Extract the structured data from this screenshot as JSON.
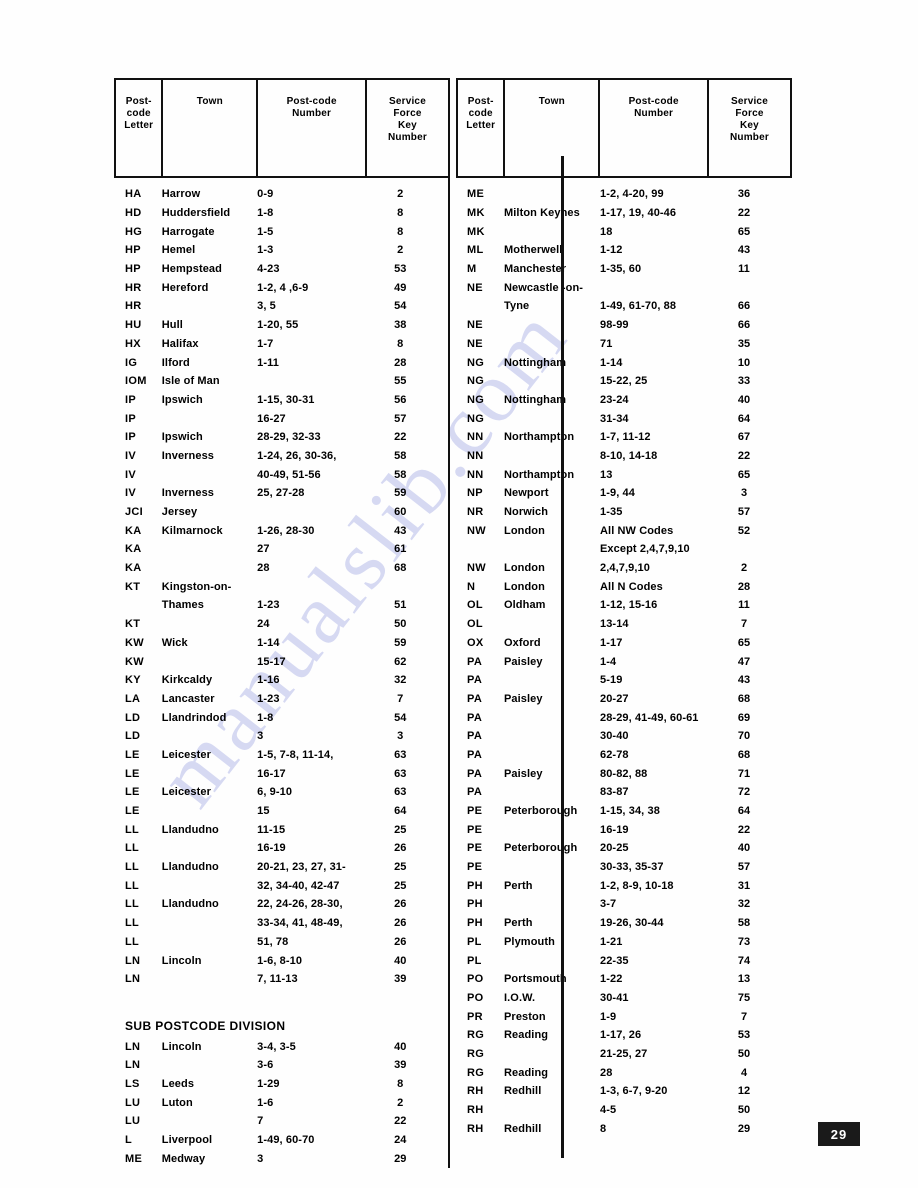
{
  "document": {
    "page_number": "29",
    "watermark_text": "manualslib.com"
  },
  "columns": {
    "postcode_letter": "Post-\ncode\nLetter",
    "postcode_letter_l1": "Post-",
    "postcode_letter_l2": "code",
    "postcode_letter_l3": "Letter",
    "town": "Town",
    "postcode_number_l1": "Post-code",
    "postcode_number_l2": "Number",
    "service_force_l1": "Service",
    "service_force_l2": "Force",
    "service_force_l3": "Key",
    "service_force_l4": "Number"
  },
  "left_table": {
    "rows": [
      {
        "letter": "HA",
        "town": "Harrow",
        "code": "0-9",
        "key": "2"
      },
      {
        "letter": "HD",
        "town": "Huddersfield",
        "code": "1-8",
        "key": "8"
      },
      {
        "letter": "HG",
        "town": "Harrogate",
        "code": "1-5",
        "key": "8"
      },
      {
        "letter": "HP",
        "town": "Hemel",
        "code": "1-3",
        "key": "2"
      },
      {
        "letter": "HP",
        "town": "Hempstead",
        "code": "4-23",
        "key": "53"
      },
      {
        "letter": "HR",
        "town": "Hereford",
        "code": "1-2, 4 ,6-9",
        "key": "49"
      },
      {
        "letter": "HR",
        "town": "",
        "code": "3, 5",
        "key": "54"
      },
      {
        "letter": "HU",
        "town": "Hull",
        "code": "1-20, 55",
        "key": "38"
      },
      {
        "letter": "HX",
        "town": "Halifax",
        "code": "1-7",
        "key": "8"
      },
      {
        "letter": "IG",
        "town": "Ilford",
        "code": "1-11",
        "key": "28"
      },
      {
        "letter": "IOM",
        "town": "Isle of Man",
        "code": "",
        "key": "55"
      },
      {
        "letter": "IP",
        "town": "Ipswich",
        "code": "1-15, 30-31",
        "key": "56"
      },
      {
        "letter": "IP",
        "town": "",
        "code": "16-27",
        "key": "57"
      },
      {
        "letter": "IP",
        "town": "Ipswich",
        "code": "28-29, 32-33",
        "key": "22"
      },
      {
        "letter": "IV",
        "town": "Inverness",
        "code": "1-24, 26, 30-36,",
        "key": "58"
      },
      {
        "letter": "IV",
        "town": "",
        "code": "40-49, 51-56",
        "key": "58"
      },
      {
        "letter": "IV",
        "town": "Inverness",
        "code": "25, 27-28",
        "key": "59"
      },
      {
        "letter": "JCI",
        "town": "Jersey",
        "code": "",
        "key": "60"
      },
      {
        "letter": "KA",
        "town": "Kilmarnock",
        "code": "1-26, 28-30",
        "key": "43"
      },
      {
        "letter": "KA",
        "town": "",
        "code": "27",
        "key": "61"
      },
      {
        "letter": "KA",
        "town": "",
        "code": "28",
        "key": "68"
      },
      {
        "letter": "KT",
        "town": "Kingston-on-",
        "code": "",
        "key": ""
      },
      {
        "letter": "",
        "town": "Thames",
        "code": "1-23",
        "key": "51"
      },
      {
        "letter": "KT",
        "town": "",
        "code": "24",
        "key": "50"
      },
      {
        "letter": "KW",
        "town": "Wick",
        "code": "1-14",
        "key": "59"
      },
      {
        "letter": "KW",
        "town": "",
        "code": "15-17",
        "key": "62"
      },
      {
        "letter": "KY",
        "town": "Kirkcaldy",
        "code": "1-16",
        "key": "32"
      },
      {
        "letter": "LA",
        "town": "Lancaster",
        "code": "1-23",
        "key": "7"
      },
      {
        "letter": "LD",
        "town": "Llandrindod",
        "code": "1-8",
        "key": "54"
      },
      {
        "letter": "LD",
        "town": "",
        "code": "3",
        "key": "3"
      },
      {
        "letter": "LE",
        "town": "Leicester",
        "code": "1-5, 7-8, 11-14,",
        "key": "63"
      },
      {
        "letter": "LE",
        "town": "",
        "code": "16-17",
        "key": "63"
      },
      {
        "letter": "LE",
        "town": "Leicester",
        "code": "6, 9-10",
        "key": "63"
      },
      {
        "letter": "LE",
        "town": "",
        "code": "15",
        "key": "64"
      },
      {
        "letter": "LL",
        "town": "Llandudno",
        "code": "11-15",
        "key": "25"
      },
      {
        "letter": "LL",
        "town": "",
        "code": "16-19",
        "key": "26"
      },
      {
        "letter": "LL",
        "town": "Llandudno",
        "code": "20-21, 23, 27, 31-",
        "key": "25"
      },
      {
        "letter": "LL",
        "town": "",
        "code": "32, 34-40, 42-47",
        "key": "25"
      },
      {
        "letter": "LL",
        "town": "Llandudno",
        "code": "22, 24-26, 28-30,",
        "key": "26"
      },
      {
        "letter": "LL",
        "town": "",
        "code": "33-34, 41, 48-49,",
        "key": "26"
      },
      {
        "letter": "LL",
        "town": "",
        "code": "51, 78",
        "key": "26"
      },
      {
        "letter": "LN",
        "town": "Lincoln",
        "code": "1-6, 8-10",
        "key": "40"
      },
      {
        "letter": "LN",
        "town": "",
        "code": "7, 11-13",
        "key": "39"
      }
    ],
    "sub_section": {
      "title": "SUB POSTCODE DIVISION",
      "rows": [
        {
          "letter": "LN",
          "town": "Lincoln",
          "code": "3-4, 3-5",
          "key": "40"
        },
        {
          "letter": "LN",
          "town": "",
          "code": "3-6",
          "key": "39"
        },
        {
          "letter": "LS",
          "town": "Leeds",
          "code": "1-29",
          "key": "8"
        },
        {
          "letter": "LU",
          "town": "Luton",
          "code": "1-6",
          "key": "2"
        },
        {
          "letter": "LU",
          "town": "",
          "code": "7",
          "key": "22"
        },
        {
          "letter": "L",
          "town": "Liverpool",
          "code": "1-49, 60-70",
          "key": "24"
        },
        {
          "letter": "ME",
          "town": "Medway",
          "code": "3",
          "key": "29"
        }
      ]
    }
  },
  "right_table": {
    "rows": [
      {
        "letter": "ME",
        "town": "",
        "code": "1-2, 4-20, 99",
        "key": "36"
      },
      {
        "letter": "MK",
        "town": "Milton Keynes",
        "code": "1-17, 19, 40-46",
        "key": "22"
      },
      {
        "letter": "MK",
        "town": "",
        "code": "18",
        "key": "65"
      },
      {
        "letter": "ML",
        "town": "Motherwell",
        "code": "1-12",
        "key": "43"
      },
      {
        "letter": "M",
        "town": "Manchester",
        "code": "1-35, 60",
        "key": "11"
      },
      {
        "letter": "NE",
        "town": "Newcastle -on-",
        "code": "",
        "key": ""
      },
      {
        "letter": "",
        "town": "Tyne",
        "code": "1-49, 61-70, 88",
        "key": "66"
      },
      {
        "letter": "NE",
        "town": "",
        "code": "98-99",
        "key": "66"
      },
      {
        "letter": "NE",
        "town": "",
        "code": "71",
        "key": "35"
      },
      {
        "letter": "NG",
        "town": "Nottingham",
        "code": "1-14",
        "key": "10"
      },
      {
        "letter": "NG",
        "town": "",
        "code": "15-22, 25",
        "key": "33"
      },
      {
        "letter": "NG",
        "town": "Nottingham",
        "code": "23-24",
        "key": "40"
      },
      {
        "letter": "NG",
        "town": "",
        "code": "31-34",
        "key": "64"
      },
      {
        "letter": "NN",
        "town": "Northampton",
        "code": "1-7, 11-12",
        "key": "67"
      },
      {
        "letter": "NN",
        "town": "",
        "code": "8-10, 14-18",
        "key": "22"
      },
      {
        "letter": "NN",
        "town": "Northampton",
        "code": "13",
        "key": "65"
      },
      {
        "letter": "NP",
        "town": "Newport",
        "code": "1-9, 44",
        "key": "3"
      },
      {
        "letter": "NR",
        "town": "Norwich",
        "code": "1-35",
        "key": "57"
      },
      {
        "letter": "NW",
        "town": "London",
        "code": "All NW Codes",
        "key": "52"
      },
      {
        "letter": "",
        "town": "",
        "code": "Except 2,4,7,9,10",
        "key": ""
      },
      {
        "letter": "NW",
        "town": "London",
        "code": "2,4,7,9,10",
        "key": "2"
      },
      {
        "letter": "N",
        "town": "London",
        "code": "All N Codes",
        "key": "28"
      },
      {
        "letter": "OL",
        "town": "Oldham",
        "code": "1-12, 15-16",
        "key": "11"
      },
      {
        "letter": "OL",
        "town": "",
        "code": "13-14",
        "key": "7"
      },
      {
        "letter": "OX",
        "town": "Oxford",
        "code": "1-17",
        "key": "65"
      },
      {
        "letter": "PA",
        "town": "Paisley",
        "code": "1-4",
        "key": "47"
      },
      {
        "letter": "PA",
        "town": "",
        "code": "5-19",
        "key": "43"
      },
      {
        "letter": "PA",
        "town": "Paisley",
        "code": "20-27",
        "key": "68"
      },
      {
        "letter": "PA",
        "town": "",
        "code": "28-29, 41-49, 60-61",
        "key": "69"
      },
      {
        "letter": "PA",
        "town": "",
        "code": "30-40",
        "key": "70"
      },
      {
        "letter": "PA",
        "town": "",
        "code": "62-78",
        "key": "68"
      },
      {
        "letter": "PA",
        "town": "Paisley",
        "code": "80-82, 88",
        "key": "71"
      },
      {
        "letter": "PA",
        "town": "",
        "code": "83-87",
        "key": "72"
      },
      {
        "letter": "PE",
        "town": "Peterborough",
        "code": "1-15, 34, 38",
        "key": "64"
      },
      {
        "letter": "PE",
        "town": "",
        "code": "16-19",
        "key": "22"
      },
      {
        "letter": "PE",
        "town": "Peterborough",
        "code": "20-25",
        "key": "40"
      },
      {
        "letter": "PE",
        "town": "",
        "code": "30-33, 35-37",
        "key": "57"
      },
      {
        "letter": "PH",
        "town": "Perth",
        "code": "1-2, 8-9, 10-18",
        "key": "31"
      },
      {
        "letter": "PH",
        "town": "",
        "code": "3-7",
        "key": "32"
      },
      {
        "letter": "PH",
        "town": "Perth",
        "code": "19-26, 30-44",
        "key": "58"
      },
      {
        "letter": "PL",
        "town": "Plymouth",
        "code": "1-21",
        "key": "73"
      },
      {
        "letter": "PL",
        "town": "",
        "code": "22-35",
        "key": "74"
      },
      {
        "letter": "PO",
        "town": "Portsmouth",
        "code": "1-22",
        "key": "13"
      },
      {
        "letter": "PO",
        "town": "I.O.W.",
        "code": "30-41",
        "key": "75"
      },
      {
        "letter": "PR",
        "town": "Preston",
        "code": "1-9",
        "key": "7"
      },
      {
        "letter": "RG",
        "town": "Reading",
        "code": "1-17, 26",
        "key": "53"
      },
      {
        "letter": "RG",
        "town": "",
        "code": "21-25, 27",
        "key": "50"
      },
      {
        "letter": "RG",
        "town": "Reading",
        "code": "28",
        "key": "4"
      },
      {
        "letter": "RH",
        "town": "Redhill",
        "code": "1-3, 6-7, 9-20",
        "key": "12"
      },
      {
        "letter": "RH",
        "town": "",
        "code": "4-5",
        "key": "50"
      },
      {
        "letter": "RH",
        "town": "Redhill",
        "code": "8",
        "key": "29"
      }
    ]
  }
}
